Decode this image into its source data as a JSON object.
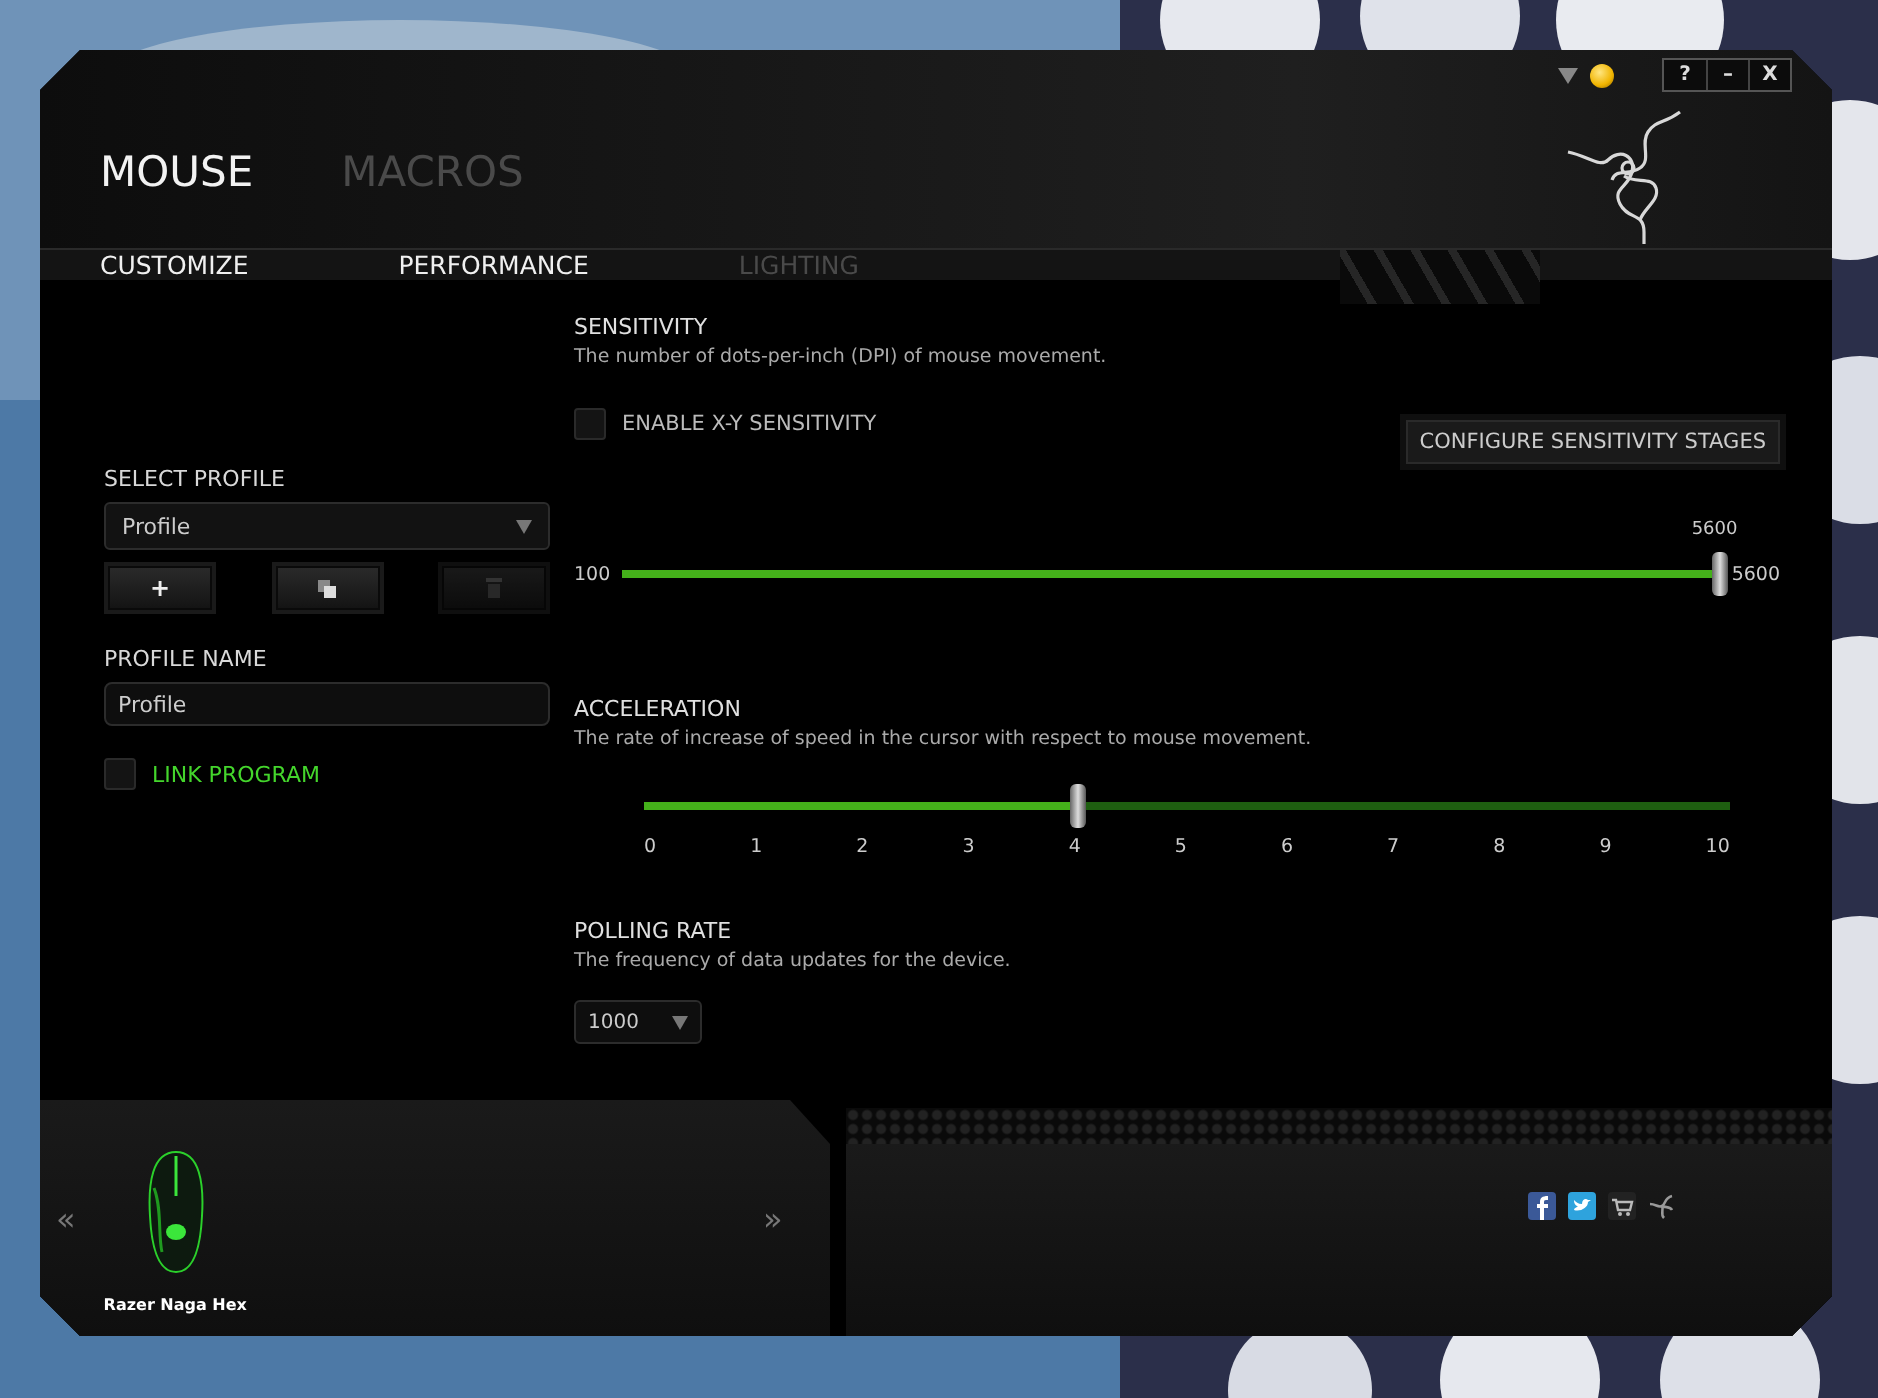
{
  "window_controls": {
    "buttons": [
      "?",
      "–",
      "X"
    ]
  },
  "main_tabs": [
    {
      "label": "MOUSE",
      "selected": true
    },
    {
      "label": "MACROS",
      "selected": false
    }
  ],
  "sub_tabs": [
    {
      "label": "CUSTOMIZE",
      "disabled": false
    },
    {
      "label": "PERFORMANCE",
      "disabled": false
    },
    {
      "label": "LIGHTING",
      "disabled": true
    }
  ],
  "sidebar": {
    "select_profile_label": "SELECT PROFILE",
    "profile_dropdown": "Profile",
    "profile_buttons": [
      {
        "kind": "add",
        "label": "+",
        "disabled": false
      },
      {
        "kind": "copy",
        "disabled": false
      },
      {
        "kind": "delete",
        "disabled": true
      }
    ],
    "profile_name_label": "PROFILE NAME",
    "profile_name_value": "Profile",
    "link_program": {
      "label": "LINK PROGRAM",
      "checked": false
    }
  },
  "sensitivity": {
    "title": "SENSITIVITY",
    "description": "The number of dots-per-inch (DPI) of mouse movement.",
    "enable_xy": {
      "label": "ENABLE X-Y SENSITIVITY",
      "checked": false
    },
    "configure_button": "CONFIGURE SENSITIVITY STAGES",
    "slider": {
      "min_label": "100",
      "thumb_label": "5600",
      "reading": "5600",
      "level": 1
    }
  },
  "acceleration": {
    "title": "ACCELERATION",
    "description": "The rate of increase of speed in the cursor with respect to mouse movement.",
    "slider": {
      "level": 0.4,
      "ticks": [
        "0",
        "1",
        "2",
        "3",
        "4",
        "5",
        "6",
        "7",
        "8",
        "9",
        "10"
      ]
    }
  },
  "polling_rate": {
    "title": "POLLING RATE",
    "description": "The frequency of data updates for the device.",
    "value": "1000"
  },
  "footer": {
    "prev": "«",
    "next": "»",
    "device_name": "Razer Naga Hex"
  }
}
